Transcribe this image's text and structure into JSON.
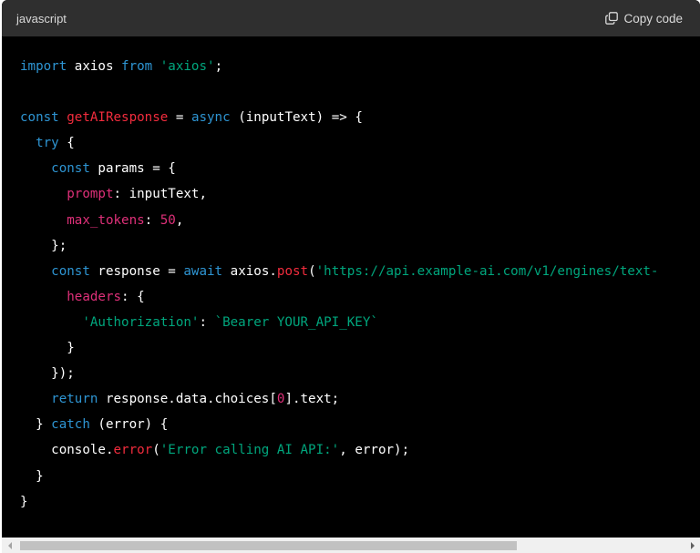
{
  "header": {
    "language": "javascript",
    "copy_label": "Copy code"
  },
  "code_lines": [
    [
      {
        "t": "kw",
        "v": "import"
      },
      {
        "t": "plain",
        "v": " axios "
      },
      {
        "t": "kw",
        "v": "from"
      },
      {
        "t": "plain",
        "v": " "
      },
      {
        "t": "str",
        "v": "'axios'"
      },
      {
        "t": "plain",
        "v": ";"
      }
    ],
    [],
    [
      {
        "t": "kw",
        "v": "const"
      },
      {
        "t": "plain",
        "v": " "
      },
      {
        "t": "fn",
        "v": "getAIResponse"
      },
      {
        "t": "plain",
        "v": " = "
      },
      {
        "t": "kw",
        "v": "async"
      },
      {
        "t": "plain",
        "v": " (inputText) => {"
      }
    ],
    [
      {
        "t": "plain",
        "v": "  "
      },
      {
        "t": "kw",
        "v": "try"
      },
      {
        "t": "plain",
        "v": " {"
      }
    ],
    [
      {
        "t": "plain",
        "v": "    "
      },
      {
        "t": "kw",
        "v": "const"
      },
      {
        "t": "plain",
        "v": " params = {"
      }
    ],
    [
      {
        "t": "plain",
        "v": "      "
      },
      {
        "t": "prop",
        "v": "prompt"
      },
      {
        "t": "plain",
        "v": ": inputText,"
      }
    ],
    [
      {
        "t": "plain",
        "v": "      "
      },
      {
        "t": "prop",
        "v": "max_tokens"
      },
      {
        "t": "plain",
        "v": ": "
      },
      {
        "t": "num",
        "v": "50"
      },
      {
        "t": "plain",
        "v": ","
      }
    ],
    [
      {
        "t": "plain",
        "v": "    };"
      }
    ],
    [
      {
        "t": "plain",
        "v": "    "
      },
      {
        "t": "kw",
        "v": "const"
      },
      {
        "t": "plain",
        "v": " response = "
      },
      {
        "t": "kw",
        "v": "await"
      },
      {
        "t": "plain",
        "v": " axios."
      },
      {
        "t": "fn",
        "v": "post"
      },
      {
        "t": "plain",
        "v": "("
      },
      {
        "t": "str",
        "v": "'https://api.example-ai.com/v1/engines/text-"
      }
    ],
    [
      {
        "t": "plain",
        "v": "      "
      },
      {
        "t": "prop",
        "v": "headers"
      },
      {
        "t": "plain",
        "v": ": {"
      }
    ],
    [
      {
        "t": "plain",
        "v": "        "
      },
      {
        "t": "str",
        "v": "'Authorization'"
      },
      {
        "t": "plain",
        "v": ": "
      },
      {
        "t": "str",
        "v": "`Bearer YOUR_API_KEY`"
      }
    ],
    [
      {
        "t": "plain",
        "v": "      }"
      }
    ],
    [
      {
        "t": "plain",
        "v": "    });"
      }
    ],
    [
      {
        "t": "plain",
        "v": "    "
      },
      {
        "t": "kw",
        "v": "return"
      },
      {
        "t": "plain",
        "v": " response.data.choices["
      },
      {
        "t": "num",
        "v": "0"
      },
      {
        "t": "plain",
        "v": "].text;"
      }
    ],
    [
      {
        "t": "plain",
        "v": "  } "
      },
      {
        "t": "kw",
        "v": "catch"
      },
      {
        "t": "plain",
        "v": " (error) {"
      }
    ],
    [
      {
        "t": "plain",
        "v": "    console."
      },
      {
        "t": "fn",
        "v": "error"
      },
      {
        "t": "plain",
        "v": "("
      },
      {
        "t": "str",
        "v": "'Error calling AI API:'"
      },
      {
        "t": "plain",
        "v": ", error);"
      }
    ],
    [
      {
        "t": "plain",
        "v": "  }"
      }
    ],
    [
      {
        "t": "plain",
        "v": "}"
      }
    ]
  ],
  "scrollbar": {
    "horizontal_scroll_fraction": 0.0,
    "visible_fraction": 0.75
  },
  "icons": {
    "copy": "copy-icon",
    "scroll_left": "scroll-left-arrow-icon",
    "scroll_right": "scroll-right-arrow-icon"
  },
  "colors": {
    "keyword": "#2e95d3",
    "function": "#f22c3d",
    "string": "#00a67d",
    "number": "#df3079",
    "property": "#df3079",
    "text": "#ffffff",
    "header_bg": "#2f2f2f",
    "code_bg": "#000000"
  }
}
